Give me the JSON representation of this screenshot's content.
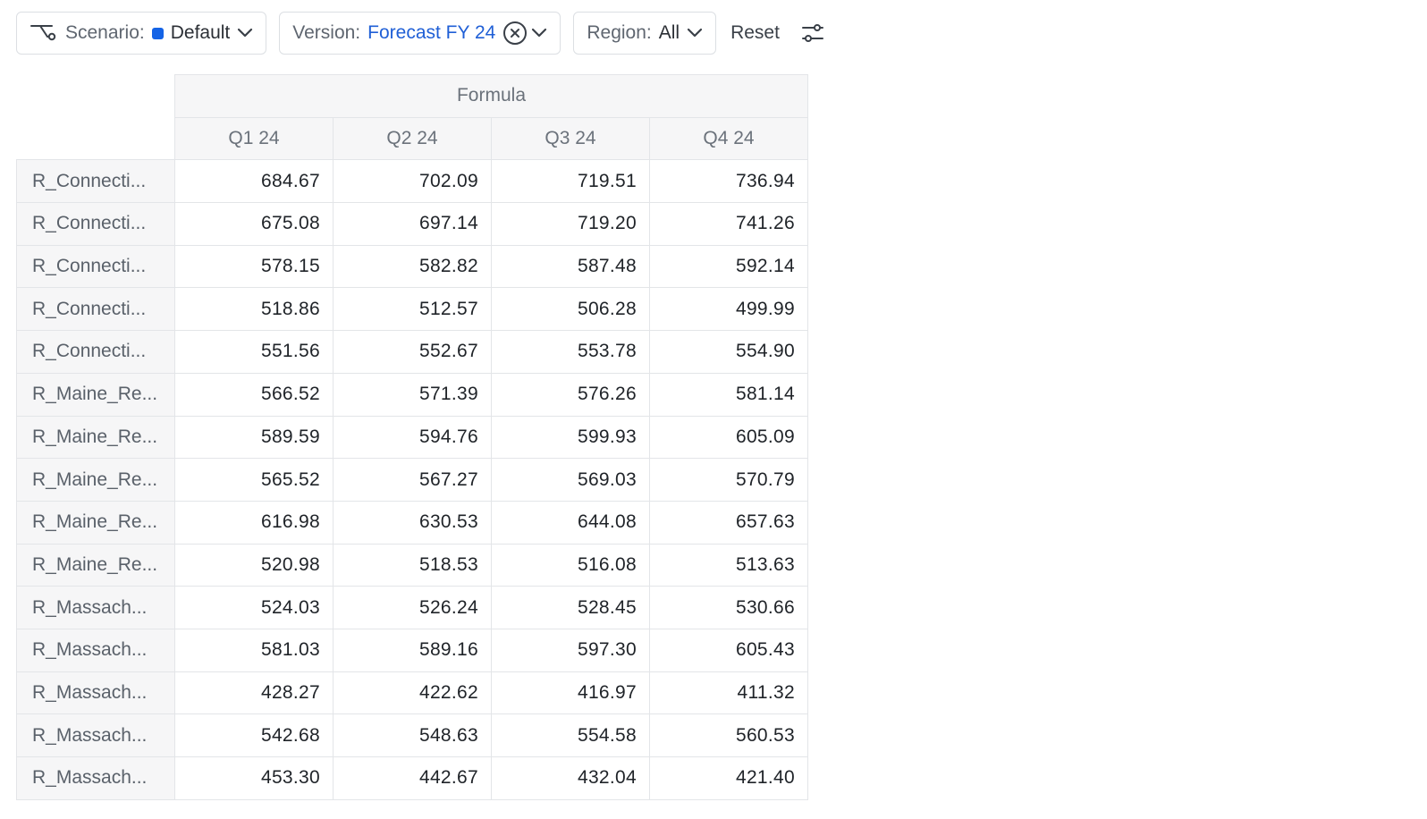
{
  "toolbar": {
    "scenario": {
      "label": "Scenario:",
      "value": "Default",
      "color": "#1463e6"
    },
    "version": {
      "label": "Version:",
      "value": "Forecast FY 24"
    },
    "region": {
      "label": "Region:",
      "value": "All"
    },
    "reset_label": "Reset"
  },
  "table": {
    "group_header": "Formula",
    "columns": [
      "Q1 24",
      "Q2 24",
      "Q3 24",
      "Q4 24"
    ],
    "rows": [
      {
        "label": "R_Connecti...",
        "values": [
          "684.67",
          "702.09",
          "719.51",
          "736.94"
        ]
      },
      {
        "label": "R_Connecti...",
        "values": [
          "675.08",
          "697.14",
          "719.20",
          "741.26"
        ]
      },
      {
        "label": "R_Connecti...",
        "values": [
          "578.15",
          "582.82",
          "587.48",
          "592.14"
        ]
      },
      {
        "label": "R_Connecti...",
        "values": [
          "518.86",
          "512.57",
          "506.28",
          "499.99"
        ]
      },
      {
        "label": "R_Connecti...",
        "values": [
          "551.56",
          "552.67",
          "553.78",
          "554.90"
        ]
      },
      {
        "label": "R_Maine_Re...",
        "values": [
          "566.52",
          "571.39",
          "576.26",
          "581.14"
        ]
      },
      {
        "label": "R_Maine_Re...",
        "values": [
          "589.59",
          "594.76",
          "599.93",
          "605.09"
        ]
      },
      {
        "label": "R_Maine_Re...",
        "values": [
          "565.52",
          "567.27",
          "569.03",
          "570.79"
        ]
      },
      {
        "label": "R_Maine_Re...",
        "values": [
          "616.98",
          "630.53",
          "644.08",
          "657.63"
        ]
      },
      {
        "label": "R_Maine_Re...",
        "values": [
          "520.98",
          "518.53",
          "516.08",
          "513.63"
        ]
      },
      {
        "label": "R_Massach...",
        "values": [
          "524.03",
          "526.24",
          "528.45",
          "530.66"
        ]
      },
      {
        "label": "R_Massach...",
        "values": [
          "581.03",
          "589.16",
          "597.30",
          "605.43"
        ]
      },
      {
        "label": "R_Massach...",
        "values": [
          "428.27",
          "422.62",
          "416.97",
          "411.32"
        ]
      },
      {
        "label": "R_Massach...",
        "values": [
          "542.68",
          "548.63",
          "554.58",
          "560.53"
        ]
      },
      {
        "label": "R_Massach...",
        "values": [
          "453.30",
          "442.67",
          "432.04",
          "421.40"
        ]
      }
    ]
  }
}
